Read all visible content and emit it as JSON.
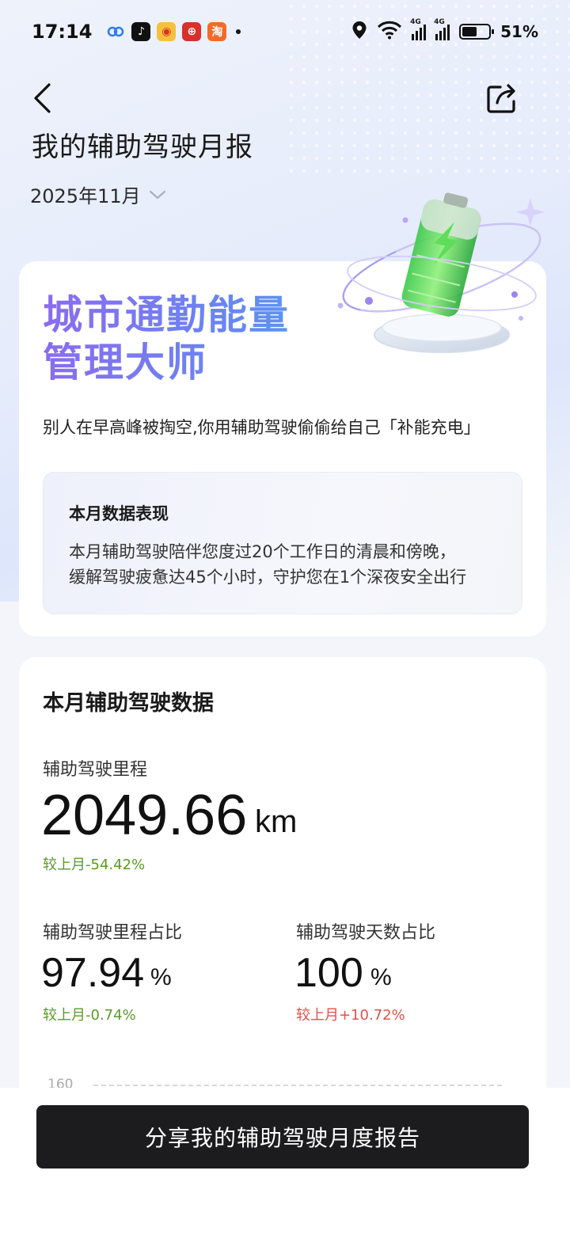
{
  "status_bar": {
    "time": "17:14",
    "battery_percent": "51%",
    "signal_label_1": "4G",
    "signal_label_2": "4G",
    "battery_level": 0.51
  },
  "header": {
    "title": "我的辅助驾驶月报",
    "month": "2025年11月"
  },
  "hero": {
    "title_line1": "城市通勤能量",
    "title_line2": "管理大师",
    "subtitle": "别人在早高峰被掏空,你用辅助驾驶偷偷给自己「补能充电」"
  },
  "performance": {
    "title": "本月数据表现",
    "line1": "本月辅助驾驶陪伴您度过20个工作日的清晨和傍晚，",
    "line2": "缓解驾驶疲惫达45个小时，守护您在1个深夜安全出行"
  },
  "stats": {
    "section_title": "本月辅助驾驶数据",
    "mileage": {
      "label": "辅助驾驶里程",
      "value": "2049.66",
      "unit": "km",
      "change": "较上月-54.42%"
    },
    "mileage_ratio": {
      "label": "辅助驾驶里程占比",
      "value": "97.94",
      "unit": "%",
      "change": "较上月-0.74%"
    },
    "days_ratio": {
      "label": "辅助驾驶天数占比",
      "value": "100",
      "unit": "%",
      "change": "较上月+10.72%"
    }
  },
  "chart": {
    "y_top_label": "160"
  },
  "cta": {
    "label": "分享我的辅助驾驶月度报告"
  },
  "colors": {
    "negative_change": "#5a9a2a",
    "positive_change": "#e0524a",
    "cta_background": "#1c1c1e"
  }
}
